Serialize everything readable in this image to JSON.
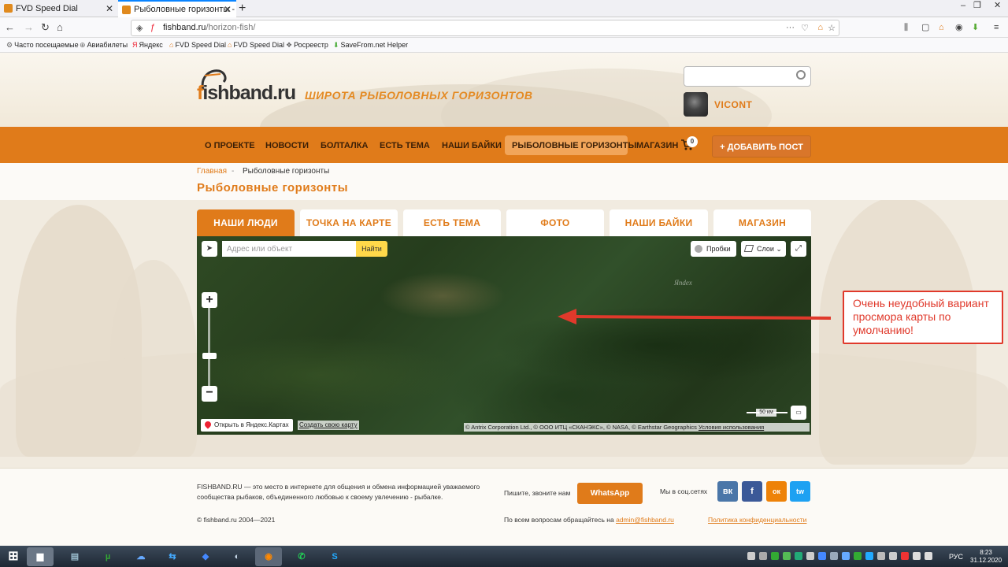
{
  "browser": {
    "tabs": [
      {
        "title": "FVD Speed Dial"
      },
      {
        "title": "Рыболовные горизонты - Fishban"
      }
    ],
    "url_domain": "fishband.ru",
    "url_path": "/horizon-fish/",
    "url_actions": "···",
    "bookmarks": [
      "Часто посещаемые",
      "Авиабилеты",
      "Яндекс",
      "FVD Speed Dial",
      "FVD Speed Dial",
      "Росреестр",
      "SaveFrom.net Helper"
    ]
  },
  "header": {
    "logo_text_a": "f",
    "logo_text_b": "ishband.ru",
    "tagline": "ШИРОТА РЫБОЛОВНЫХ ГОРИЗОНТОВ",
    "search_placeholder": "",
    "username": "VICONT"
  },
  "menu": {
    "items": [
      "О ПРОЕКТЕ",
      "НОВОСТИ",
      "БОЛТАЛКА",
      "ЕСТЬ ТЕМА",
      "НАШИ БАЙКИ",
      "РЫБОЛОВНЫЕ ГОРИЗОНТЫ",
      "МАГАЗИН"
    ],
    "cart_count": "0",
    "add_post": "ДОБАВИТЬ ПОСТ",
    "add_post_icon": "+"
  },
  "breadcrumb": {
    "home": "Главная",
    "separator": "-",
    "current": "Рыболовные горизонты"
  },
  "page_title": "Рыболовные горизонты",
  "content_tabs": [
    "НАШИ ЛЮДИ",
    "ТОЧКА НА КАРТЕ",
    "ЕСТЬ ТЕМА",
    "ФОТО",
    "НАШИ БАЙКИ",
    "МАГАЗИН"
  ],
  "map": {
    "address_placeholder": "Адрес или объект",
    "find": "Найти",
    "traffic": "Пробки",
    "layers": "Слои",
    "layers_chevron": "⌄",
    "zoom_in": "+",
    "zoom_out": "−",
    "watermark": "Яndex",
    "scale": "50 км",
    "open_yandex": "Открыть в Яндекс.Картах",
    "create_map": "Создать свою карту",
    "attribution": "© Antrix Corporation Ltd., © ООО ИТЦ «СКАНЭКС», © NASA, © Earthstar Geographics",
    "terms": "Условия использования"
  },
  "annotation": {
    "text": "Очень неудобный вариант просмора карты по умолчанию!",
    "color": "#e0392b"
  },
  "footer": {
    "description": "FISHBAND.RU — это место в интернете для общения и обмена информацией уважаемого сообщества рыбаков, объединенного любовью к своему увлечению - рыбалке.",
    "copyright": "© fishband.ru 2004—2021",
    "write_call": "Пишите, звоните нам",
    "whatsapp": "WhatsApp",
    "social_label": "Мы в соц.сетях",
    "social": [
      "вк",
      "f",
      "ок",
      "tw"
    ],
    "questions": "По всем вопросам обращайтесь на",
    "email": "admin@fishband.ru",
    "policy": "Политика конфиденциальности"
  },
  "taskbar": {
    "lang": "РУС",
    "time": "8:23",
    "date": "31.12.2020"
  },
  "colors": {
    "brand": "#e07b1a",
    "annotation": "#e0392b",
    "whatsapp": "#e07b1a"
  }
}
